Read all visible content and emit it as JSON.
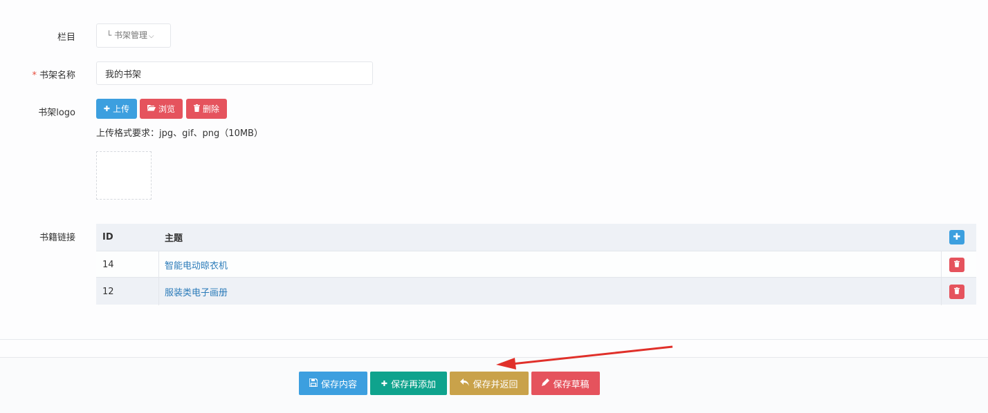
{
  "form": {
    "column_label": "栏目",
    "column_value": "└ 书架管理",
    "name_label": "书架名称",
    "name_required_mark": "*",
    "name_value": "我的书架",
    "logo_label": "书架logo",
    "upload_label": "上传",
    "browse_label": "浏览",
    "delete_label": "删除",
    "upload_hint": "上传格式要求：jpg、gif、png（10MB）",
    "books_label": "书籍链接"
  },
  "table": {
    "headers": {
      "id": "ID",
      "topic": "主题"
    },
    "rows": [
      {
        "id": "14",
        "topic": "智能电动晾衣机"
      },
      {
        "id": "12",
        "topic": "服装类电子画册"
      }
    ]
  },
  "footer": {
    "save_content": "保存内容",
    "save_add": "保存再添加",
    "save_return": "保存并返回",
    "save_draft": "保存草稿"
  },
  "colors": {
    "blue": "#3c9fdf",
    "red": "#e5535d",
    "teal": "#0fa38d",
    "gold": "#c9a24a",
    "link": "#2b7bb9",
    "arrow": "#e0302a"
  },
  "icons": {
    "upload": "plus-icon",
    "browse": "folder-open-icon",
    "delete": "trash-icon",
    "save_content": "floppy-disk-icon",
    "save_add": "plus-icon",
    "save_return": "reply-icon",
    "save_draft": "pencil-icon"
  }
}
